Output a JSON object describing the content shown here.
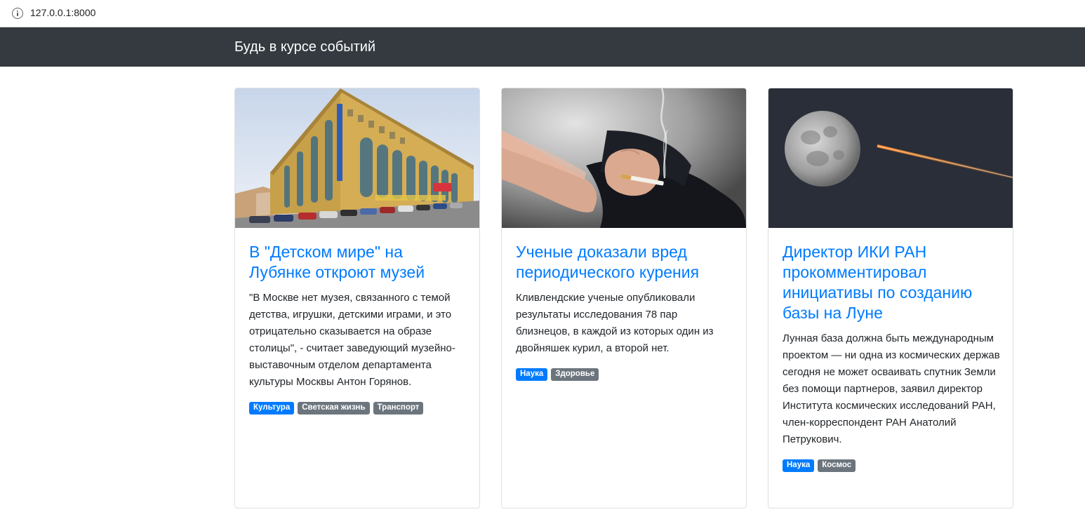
{
  "browser": {
    "url": "127.0.0.1:8000"
  },
  "navbar": {
    "brand": "Будь в курсе событий"
  },
  "cards": [
    {
      "title": "В \"Детском мире\" на Лубянке откроют музей",
      "text": "\"В Москве нет музея, связанного с темой детства, игрушки, детскими играми, и это отрицательно сказывается на образе столицы\", - считает заведующий музейно-выставочным отделом департамента культуры Москвы Антон Горянов.",
      "tags": [
        "Культура",
        "Светская жизнь",
        "Транспорт"
      ],
      "image": "building-photo"
    },
    {
      "title": "Ученые доказали вред периодического курения",
      "text": "Кливлендские ученые опубликовали результаты исследования 78 пар близнецов, в каждой из которых один из двойняшек курил, а второй нет.",
      "tags": [
        "Наука",
        "Здоровье"
      ],
      "image": "smoking-photo"
    },
    {
      "title": "Директор ИКИ РАН прокомментировал инициативы по созданию базы на Луне",
      "text": "Лунная база должна быть международным проектом — ни одна из космических держав сегодня не может осваивать спутник Земли без помощи партнеров, заявил директор Института космических исследований РАН, член-корреспондент РАН Анатолий Петрукович.",
      "tags": [
        "Наука",
        "Космос"
      ],
      "image": "moon-photo"
    }
  ],
  "colors": {
    "navbar": "#343a40",
    "link": "#007bff",
    "badge_primary": "#007bff",
    "badge_secondary": "#6c757d"
  }
}
